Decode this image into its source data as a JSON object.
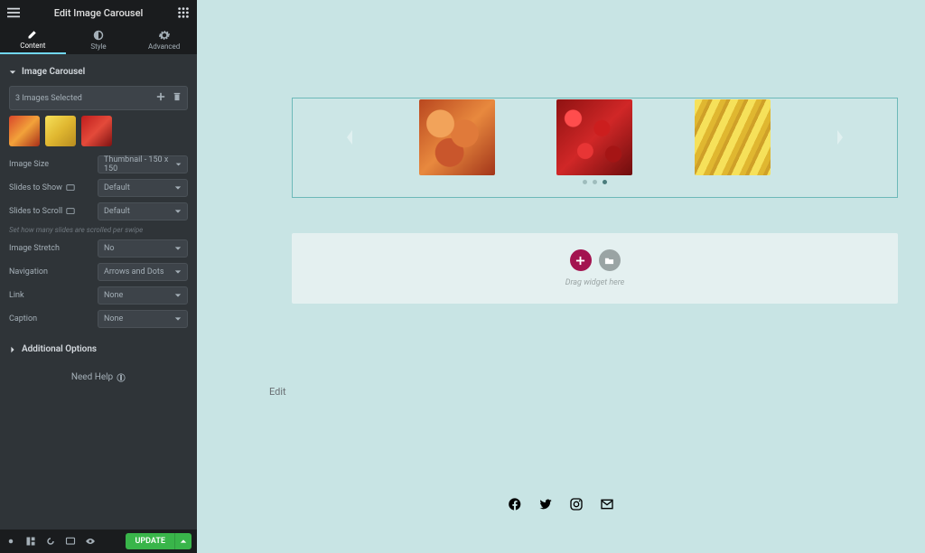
{
  "header": {
    "title": "Edit Image Carousel"
  },
  "tabs": {
    "content": "Content",
    "style": "Style",
    "advanced": "Advanced"
  },
  "section": {
    "imageCarousel": "Image Carousel",
    "additionalOptions": "Additional Options"
  },
  "selector": {
    "count": "3 Images Selected"
  },
  "controls": {
    "imageSize": {
      "label": "Image Size",
      "value": "Thumbnail - 150 x 150"
    },
    "slidesToShow": {
      "label": "Slides to Show",
      "value": "Default"
    },
    "slidesToScroll": {
      "label": "Slides to Scroll",
      "value": "Default",
      "hint": "Set how many slides are scrolled per swipe"
    },
    "imageStretch": {
      "label": "Image Stretch",
      "value": "No"
    },
    "navigation": {
      "label": "Navigation",
      "value": "Arrows and Dots"
    },
    "link": {
      "label": "Link",
      "value": "None"
    },
    "caption": {
      "label": "Caption",
      "value": "None"
    }
  },
  "help": "Need Help",
  "footer": {
    "update": "UPDATE"
  },
  "canvas": {
    "dropHint": "Drag widget here",
    "edit": "Edit"
  }
}
